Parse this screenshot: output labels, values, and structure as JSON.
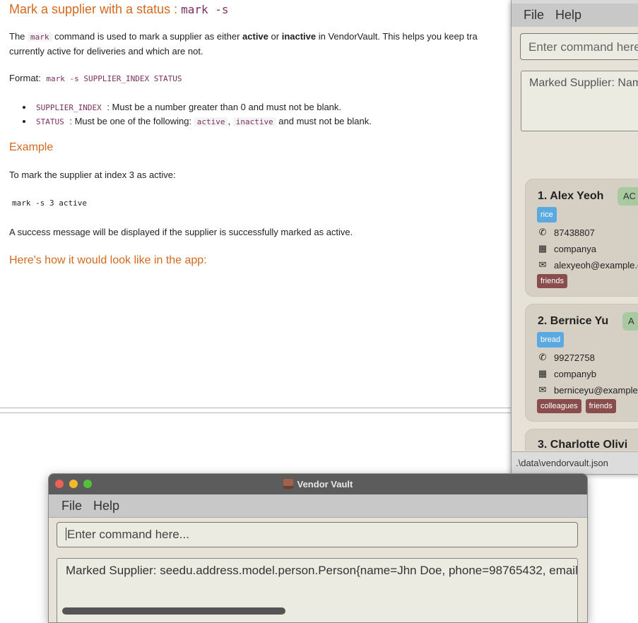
{
  "doc": {
    "heading_text": "Mark a supplier with a status : ",
    "heading_code": "mark -s",
    "intro_prefix": "The ",
    "intro_code": "mark",
    "intro_mid1": " command is used to mark a supplier as either ",
    "intro_bold1": "active",
    "intro_mid2": " or ",
    "intro_bold2": "inactive",
    "intro_mid3": " in VendorVault. This helps you keep tra",
    "intro_line2": "currently active for deliveries and which are not.",
    "format_label": "Format:",
    "format_code": "mark -s SUPPLIER_INDEX STATUS",
    "bullets": [
      {
        "code": "SUPPLIER_INDEX",
        "text": " : Must be a number greater than 0 and must not be blank."
      },
      {
        "code": "STATUS",
        "text": " : Must be one of the following:",
        "code2": "active",
        "sep": ",",
        "code3": "inactive",
        "text2": " and must not be blank."
      }
    ],
    "example_heading": "Example",
    "example_text": "To mark the supplier at index 3 as active:",
    "example_code": "mark -s 3 active",
    "success_text": "A success message will be displayed if the supplier is successfully marked as active.",
    "app_heading": "Here's how it would look like in the app:"
  },
  "right_window": {
    "menu": [
      "File",
      "Help"
    ],
    "command_placeholder": "Enter command here.",
    "result_text": "Marked Supplier: Nam",
    "cards": [
      {
        "index_name": "1.  Alex Yeoh",
        "status": "AC",
        "product": "rice",
        "phone": "87438807",
        "company": "companya",
        "email": "alexyeoh@example.c",
        "tags": [
          "friends"
        ]
      },
      {
        "index_name": "2.  Bernice Yu",
        "status": "A",
        "product": "bread",
        "phone": "99272758",
        "company": "companyb",
        "email": "berniceyu@example.",
        "tags": [
          "colleagues",
          "friends"
        ]
      }
    ],
    "next_card_partial": "3.  Charlotte Olivi",
    "status_bar": ".\\data\\vendorvault.json"
  },
  "bottom_window": {
    "title": "Vendor Vault",
    "menu": [
      "File",
      "Help"
    ],
    "command_placeholder": "Enter command here...",
    "result_text": "Marked Supplier: seedu.address.model.person.Person{name=Jhn Doe, phone=98765432, email=j"
  },
  "colors": {
    "heading": "#d4691e",
    "code": "#7a3060",
    "active_badge": "#a9c9a0",
    "product_tag": "#5aa9e0",
    "tag": "#8a4d4d"
  }
}
